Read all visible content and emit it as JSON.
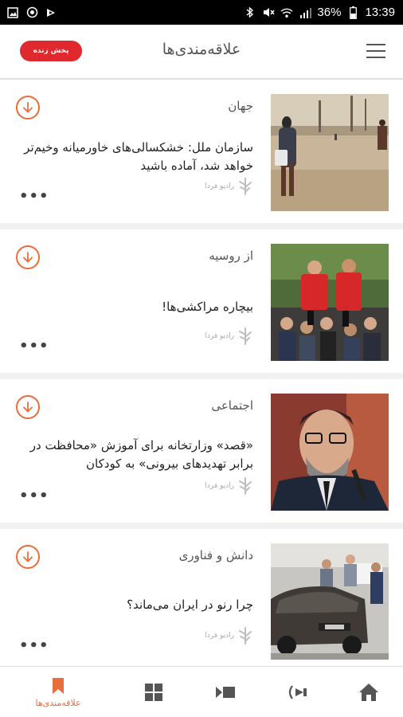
{
  "status_bar": {
    "battery": "36%",
    "time": "13:39"
  },
  "header": {
    "title": "علاقه‌مندی‌ها",
    "live_button": "پخش زنده",
    "menu_icon": "hamburger-menu-icon"
  },
  "source_label": "رادیو فردا",
  "articles": [
    {
      "category": "جهان",
      "headline": "سازمان ملل: خشکسالی‌های خاورمیانه وخیم‌تر خواهد شد، آماده باشید",
      "image": "dusty-road-people-photo"
    },
    {
      "category": "از روسیه",
      "headline": "بیچاره مراکشی‌ها!",
      "image": "football-fans-photo"
    },
    {
      "category": "اجتماعی",
      "headline": "«قصد» وزارتخانه برای آموزش «محافظت در برابر تهدیدهای بیرونی» به کودکان",
      "image": "minister-portrait-photo"
    },
    {
      "category": "دانش و فناوری",
      "headline": "چرا رنو در ایران می‌ماند؟",
      "image": "car-showroom-photo"
    }
  ],
  "bottom_nav": {
    "active_label": "علاقه‌مندی‌ها",
    "items": [
      "bookmark-icon",
      "grid-icon",
      "video-icon",
      "radio-live-icon",
      "home-icon"
    ]
  },
  "colors": {
    "accent": "#e76e3c",
    "live": "#e0292f",
    "statusbar": "#000000"
  }
}
